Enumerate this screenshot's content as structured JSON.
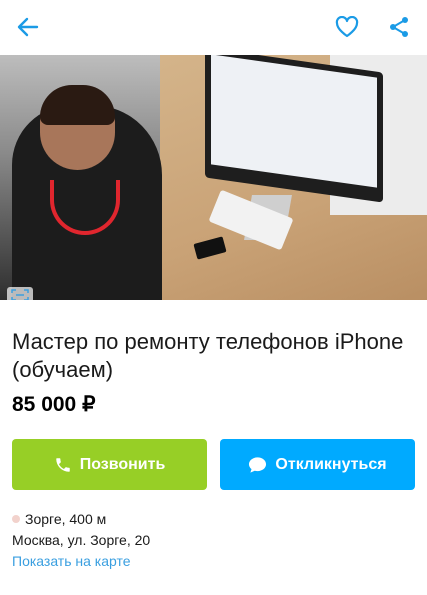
{
  "header": {
    "back_icon": "arrow-left-icon",
    "favorite_icon": "heart-icon",
    "share_icon": "share-icon",
    "accent": "#1b9be6"
  },
  "listing": {
    "title": "Мастер по ремонту телефонов iPhone (обучаем)",
    "price": "85 000 ₽",
    "call_label": "Позвонить",
    "reply_label": "Откликнуться",
    "call_color": "#97cf26",
    "reply_color": "#00aaff",
    "metro": "Зорге, 400 м",
    "address": "Москва, ул. Зорге, 20",
    "map_link": "Показать на карте"
  }
}
